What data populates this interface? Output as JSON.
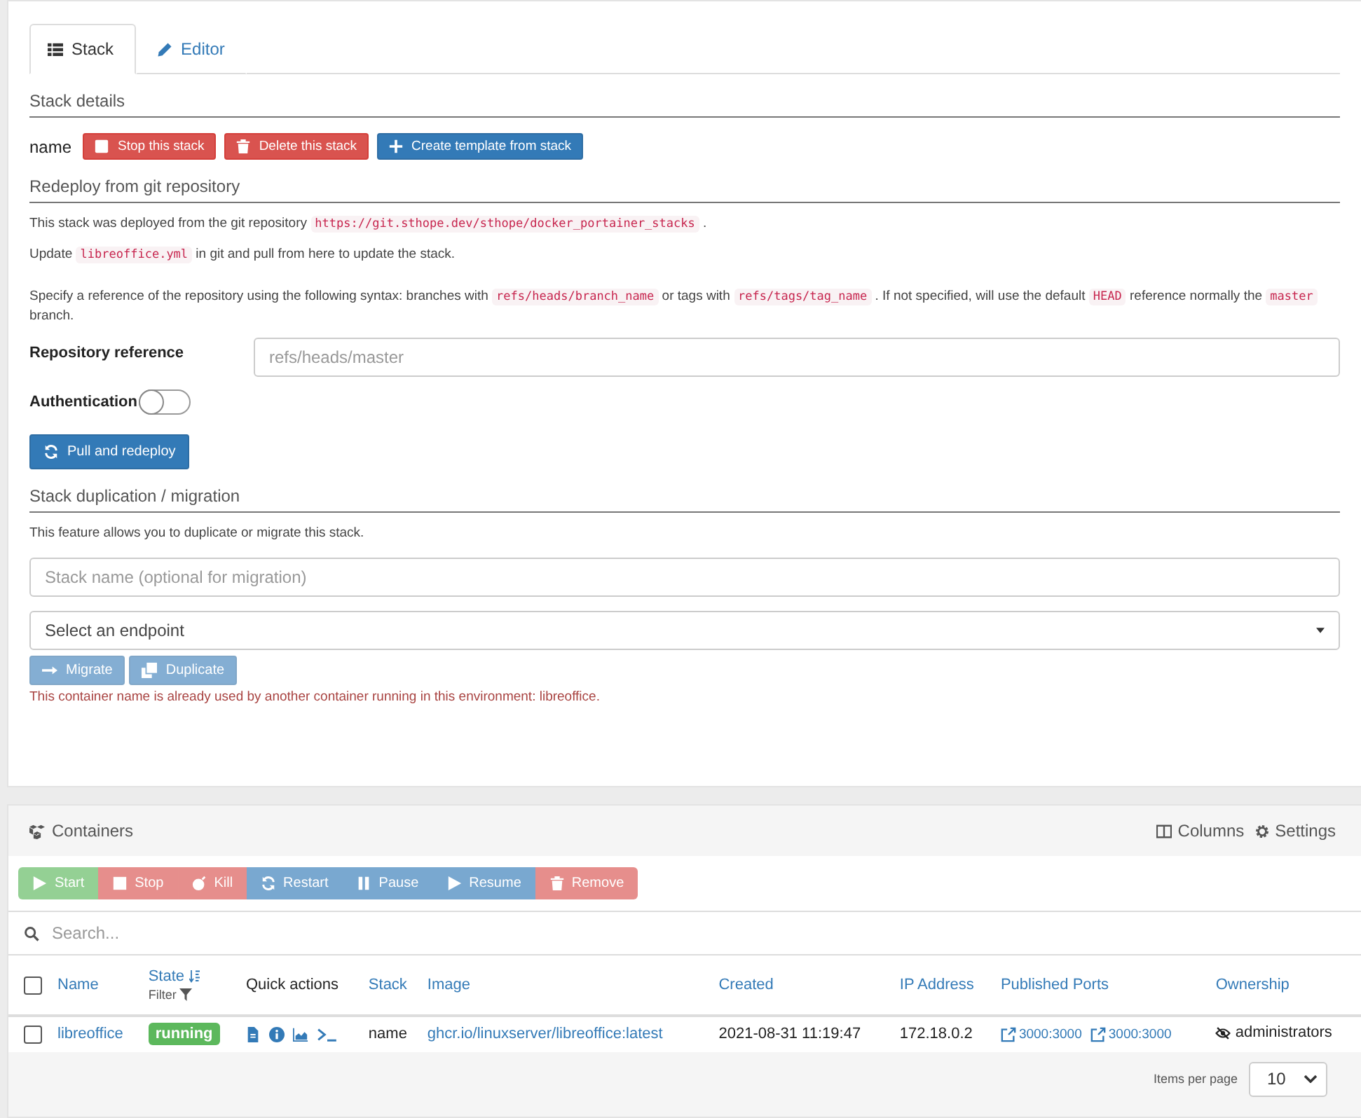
{
  "tabs": [
    {
      "label": "Stack",
      "selected": true
    },
    {
      "label": "Editor",
      "selected": false
    }
  ],
  "stack_details": {
    "heading": "Stack details",
    "name_label": "name",
    "buttons": [
      {
        "label": "Stop this stack",
        "kind": "danger"
      },
      {
        "label": "Delete this stack",
        "kind": "danger"
      },
      {
        "label": "Create template from stack",
        "kind": "primary"
      }
    ]
  },
  "redeploy": {
    "heading": "Redeploy from git repository",
    "paragraphs": [
      [
        {
          "text": "This stack was deployed from the git repository "
        },
        {
          "code": "https://git.sthope.dev/sthope/docker_portainer_stacks"
        },
        {
          "text": " ."
        }
      ],
      [
        {
          "text": "Update "
        },
        {
          "code": "libreoffice.yml"
        },
        {
          "text": " in git and pull from here to update the stack."
        }
      ],
      [
        {
          "text": "Specify a reference of the repository using the following syntax: branches with "
        },
        {
          "code": "refs/heads/branch_name"
        },
        {
          "text": " or tags with "
        },
        {
          "code": "refs/tags/tag_name"
        },
        {
          "text": " . If not specified, will use the default "
        },
        {
          "code": "HEAD"
        },
        {
          "text": " reference normally the "
        },
        {
          "code": "master"
        },
        {
          "text": " branch."
        }
      ]
    ],
    "reference": {
      "label": "Repository reference",
      "placeholder": "refs/heads/master"
    },
    "authentication": {
      "label": "Authentication",
      "on": false
    },
    "button": {
      "label": "Pull and redeploy"
    }
  },
  "duplication": {
    "heading": "Stack duplication / migration",
    "description": "This feature allows you to duplicate or migrate this stack.",
    "name_field": {
      "placeholder": "Stack name (optional for migration)"
    },
    "endpoint_select": {
      "placeholder": "Select an endpoint"
    },
    "buttons": [
      {
        "label": "Migrate",
        "disabled": true
      },
      {
        "label": "Duplicate",
        "disabled": true
      }
    ],
    "error": "This container name is already used by another container running in this environment: libreoffice."
  },
  "containers": {
    "title": "Containers",
    "columns_label": "Columns",
    "settings_label": "Settings",
    "actions": [
      {
        "label": "Start",
        "kind": "success",
        "disabled": true
      },
      {
        "label": "Stop",
        "kind": "danger",
        "disabled": true
      },
      {
        "label": "Kill",
        "kind": "danger",
        "disabled": true
      },
      {
        "label": "Restart",
        "kind": "primary",
        "disabled": true
      },
      {
        "label": "Pause",
        "kind": "primary",
        "disabled": true
      },
      {
        "label": "Resume",
        "kind": "primary",
        "disabled": true
      },
      {
        "label": "Remove",
        "kind": "danger",
        "disabled": true
      }
    ],
    "search": {
      "placeholder": "Search..."
    },
    "table": {
      "all_checked": false,
      "columns": [
        {
          "label": "Name",
          "link": true
        },
        {
          "label": "State",
          "link": true,
          "sub": "Filter"
        },
        {
          "label": "Quick actions",
          "link": false
        },
        {
          "label": "Stack",
          "link": true
        },
        {
          "label": "Image",
          "link": true
        },
        {
          "label": "Created",
          "link": true
        },
        {
          "label": "IP Address",
          "link": true
        },
        {
          "label": "Published Ports",
          "link": true
        },
        {
          "label": "Ownership",
          "link": true
        }
      ],
      "rows": [
        {
          "checked": false,
          "name": "libreoffice",
          "state": "running",
          "stack": "name",
          "image": "ghcr.io/linuxserver/libreoffice:latest",
          "created": "2021-08-31 11:19:47",
          "ip": "172.18.0.2",
          "ports": [
            "3000:3000",
            "3000:3000"
          ],
          "ownership": "administrators"
        }
      ]
    },
    "pagination": {
      "label": "Items per page",
      "value": "10"
    }
  }
}
